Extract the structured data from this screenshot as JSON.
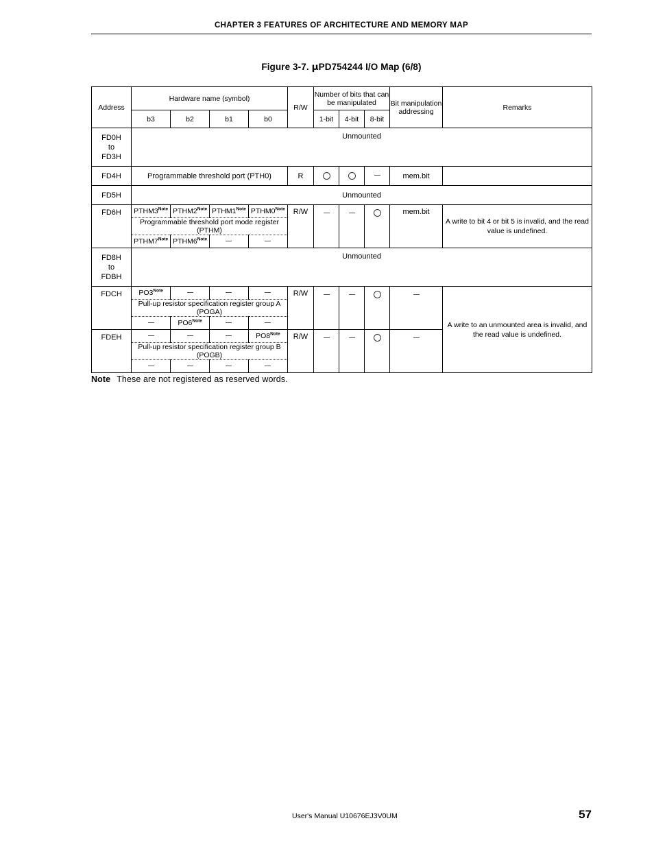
{
  "header": {
    "chapter_title": "CHAPTER 3   FEATURES OF ARCHITECTURE AND MEMORY MAP"
  },
  "figure": {
    "label": "Figure 3-7.",
    "mu": "μ",
    "title_rest": "PD754244 I/O Map (6/8)"
  },
  "table": {
    "columns": {
      "address": "Address",
      "hardware_name": "Hardware name (symbol)",
      "b3": "b3",
      "b2": "b2",
      "b1": "b1",
      "b0": "b0",
      "rw": "R/W",
      "num_bits": "Number of bits that can be manipulated",
      "bit1": "1-bit",
      "bit4": "4-bit",
      "bit8": "8-bit",
      "bit_manipulation": "Bit manipulation addressing",
      "remarks": "Remarks"
    },
    "rows": [
      {
        "address": "FD0H\nto\nFD3H",
        "address_lines": [
          "FD0H",
          "to",
          "FD3H"
        ],
        "hardware": "Unmounted",
        "rw": "",
        "bit1": "",
        "bit4": "",
        "bit8": "",
        "bitmanip": "",
        "remarks": ""
      },
      {
        "address_lines": [
          "FD4H"
        ],
        "hardware": "Programmable threshold port (PTH0)",
        "rw": "R",
        "bit1": "circle",
        "bit4": "circle",
        "bit8": "dash",
        "bitmanip": "mem.bit",
        "remarks": ""
      },
      {
        "address_lines": [
          "FD5H"
        ],
        "hardware": "Unmounted",
        "rw": "",
        "bit1": "",
        "bit4": "",
        "bit8": "",
        "bitmanip": "",
        "remarks": ""
      },
      {
        "address_lines": [
          "FD6H"
        ],
        "register": {
          "bits_top": [
            "PTHM3",
            "PTHM2",
            "PTHM1",
            "PTHM0"
          ],
          "bits_top_sup": [
            "Note",
            "Note",
            "Note",
            "Note"
          ],
          "name": "Programmable threshold port mode register (PTHM)",
          "bits_bottom": [
            "PTHM7",
            "PTHM6",
            "dash",
            "dash"
          ],
          "bits_bottom_sup": [
            "Note",
            "Note",
            "",
            ""
          ]
        },
        "rw": "R/W",
        "bit1": "dash",
        "bit4": "dash",
        "bit8": "circle",
        "bitmanip": "mem.bit",
        "remarks": "A write to bit 4 or bit 5 is invalid, and the read value is undefined."
      },
      {
        "address_lines": [
          "FD8H",
          "to",
          "FDBH"
        ],
        "hardware": "Unmounted",
        "rw": "",
        "bit1": "",
        "bit4": "",
        "bit8": "",
        "bitmanip": "",
        "remarks": ""
      },
      {
        "address_lines": [
          "FDCH"
        ],
        "register": {
          "bits_top": [
            "PO3",
            "dash",
            "dash",
            "dash"
          ],
          "bits_top_sup": [
            "Note",
            "",
            "",
            ""
          ],
          "name": "Pull-up resistor specification register group A (POGA)",
          "bits_bottom": [
            "dash",
            "PO6",
            "dash",
            "dash"
          ],
          "bits_bottom_sup": [
            "",
            "Note",
            "",
            ""
          ]
        },
        "rw": "R/W",
        "bit1": "dash",
        "bit4": "dash",
        "bit8": "circle",
        "bitmanip": "dash",
        "remarks": "A write to an unmounted area is invalid, and the read value is undefined."
      },
      {
        "address_lines": [
          "FDEH"
        ],
        "register": {
          "bits_top": [
            "dash",
            "dash",
            "dash",
            "PO8"
          ],
          "bits_top_sup": [
            "",
            "",
            "",
            "Note"
          ],
          "name": "Pull-up resistor specification register group B (POGB)",
          "bits_bottom": [
            "dash",
            "dash",
            "dash",
            "dash"
          ],
          "bits_bottom_sup": [
            "",
            "",
            "",
            ""
          ]
        },
        "rw": "R/W",
        "bit1": "dash",
        "bit4": "dash",
        "bit8": "circle",
        "bitmanip": "dash",
        "remarks": ""
      }
    ]
  },
  "note": {
    "label": "Note",
    "text": "These are not registered as reserved words."
  },
  "footer": {
    "manual": "User's Manual  U10676EJ3V0UM",
    "page_number": "57"
  }
}
